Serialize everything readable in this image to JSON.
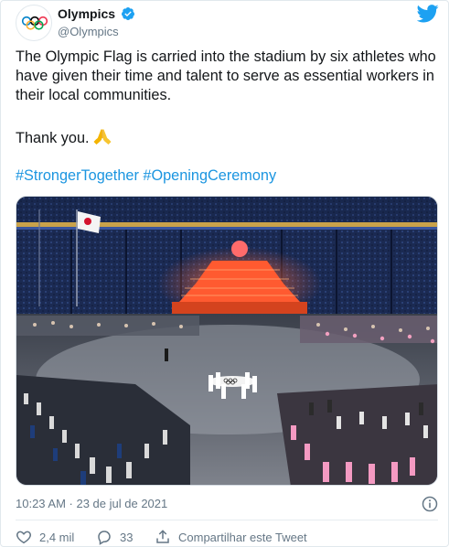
{
  "account": {
    "display_name": "Olympics",
    "handle": "@Olympics",
    "verified": true,
    "avatar_icon": "olympic-rings-icon"
  },
  "tweet": {
    "text": "The Olympic Flag is carried into the stadium by six athletes who have given their time and talent to serve as essential workers in their local communities.",
    "thanks": "Thank you.",
    "emoji": "folded-hands-emoji",
    "hashtags": [
      "#StrongerTogether",
      "#OpeningCeremony"
    ]
  },
  "media": {
    "kind": "photo"
  },
  "meta": {
    "timestamp": "10:23 AM · 23 de jul de 2021"
  },
  "actions": {
    "likes": "2,4 mil",
    "replies": "33",
    "share_label": "Compartilhar este Tweet"
  },
  "colors": {
    "link": "#1b95e0",
    "secondary_text": "#657786",
    "twitter_blue": "#1da1f2",
    "border": "#e1e8ed"
  }
}
